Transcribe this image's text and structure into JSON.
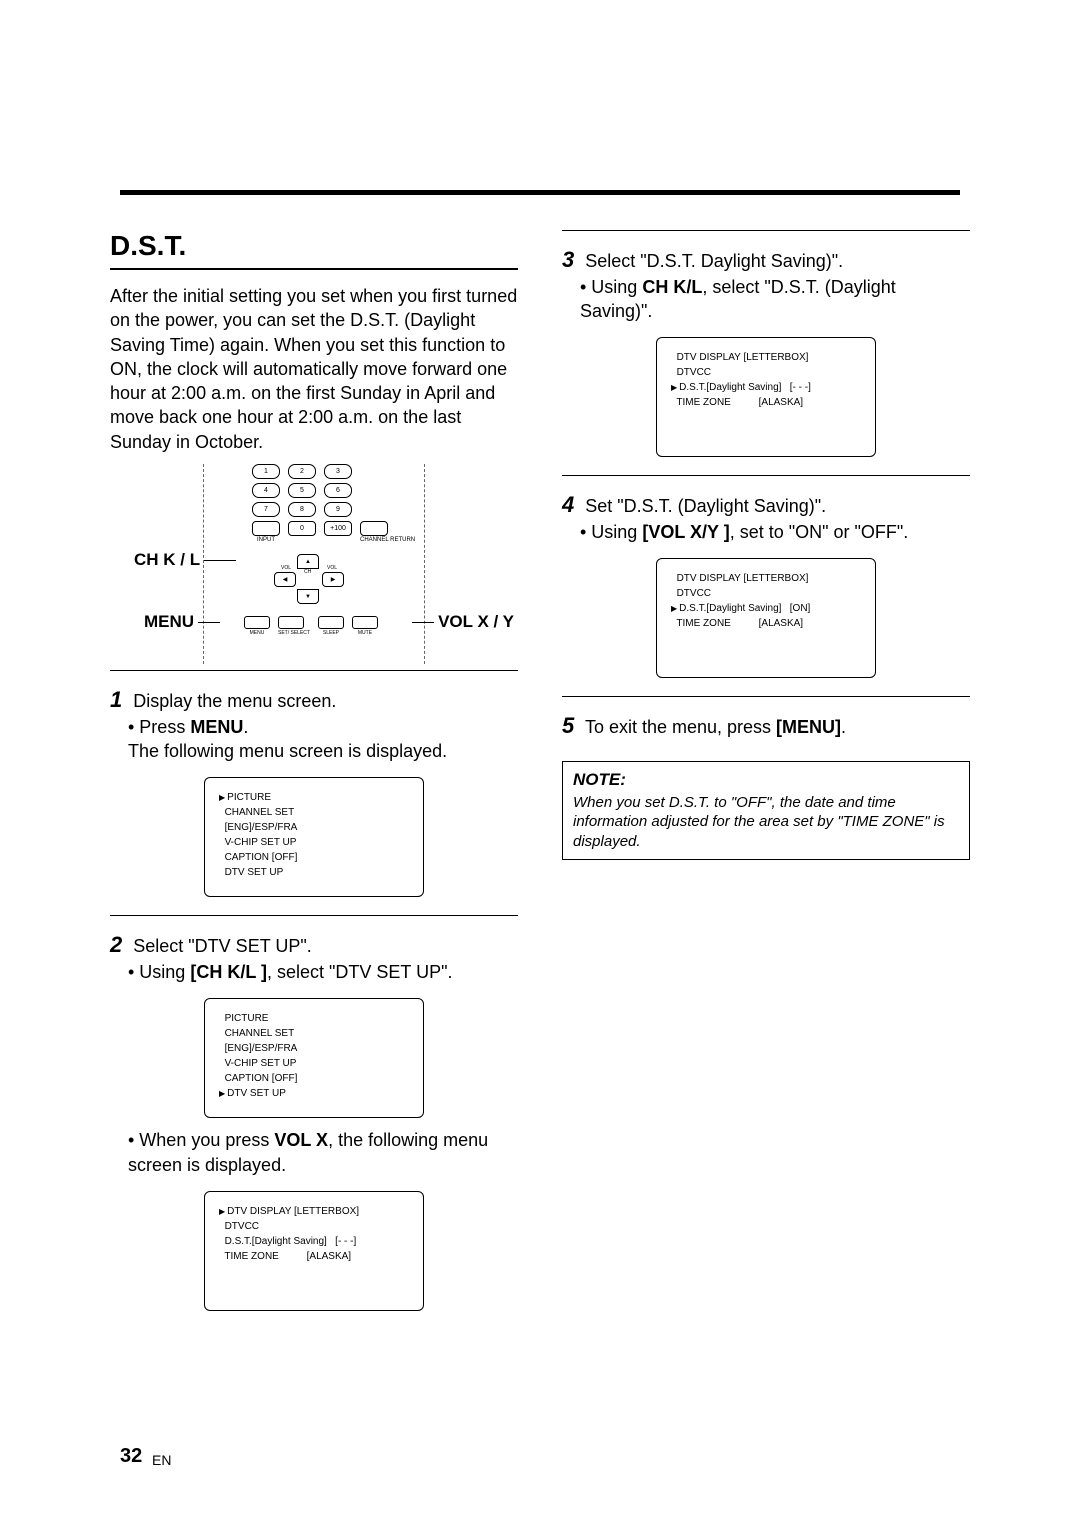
{
  "section_title": "D.S.T.",
  "intro": "After the initial setting you set when you first turned on the power, you can set the D.S.T. (Daylight Saving Time) again. When you set this function to ON, the clock will automatically move forward one hour at 2:00 a.m. on the first Sunday in April and move back one hour at 2:00 a.m. on the last Sunday in October.",
  "remote": {
    "label_ch": "CH K / L",
    "label_menu": "MENU",
    "label_vol": "VOL X / Y",
    "row4_labels": {
      "input": "INPUT",
      "plus": "+100",
      "chret": "CHANNEL\nRETURN"
    },
    "cross": {
      "up": "CH",
      "down": "CH",
      "left": "VOL",
      "right": "VOL"
    },
    "bottom": [
      "MENU",
      "SET/\nSELECT",
      "SLEEP",
      "MUTE"
    ]
  },
  "steps_left": [
    {
      "num": "1",
      "text": "Display the menu screen.",
      "sub": [
        "• Press ",
        "MENU",
        "."
      ],
      "sub2": "The following menu screen is displayed.",
      "screen": [
        {
          "arrow": true,
          "text": "PICTURE"
        },
        {
          "arrow": false,
          "text": "CHANNEL SET"
        },
        {
          "arrow": false,
          "text": "[ENG]/ESP/FRA"
        },
        {
          "arrow": false,
          "text": "V-CHIP SET UP"
        },
        {
          "arrow": false,
          "text": "CAPTION [OFF]"
        },
        {
          "arrow": false,
          "text": "DTV SET UP"
        }
      ]
    },
    {
      "num": "2",
      "text": "Select \"DTV SET UP\".",
      "sub": [
        "• Using ",
        "[CH K/L ]",
        ", select \"DTV SET UP\"."
      ],
      "screen": [
        {
          "arrow": false,
          "text": "PICTURE"
        },
        {
          "arrow": false,
          "text": "CHANNEL SET"
        },
        {
          "arrow": false,
          "text": "[ENG]/ESP/FRA"
        },
        {
          "arrow": false,
          "text": "V-CHIP SET UP"
        },
        {
          "arrow": false,
          "text": "CAPTION [OFF]"
        },
        {
          "arrow": true,
          "text": "DTV SET UP"
        }
      ],
      "sub3": [
        "• When you press ",
        "VOL X",
        ", the following menu screen is displayed."
      ],
      "screen2": [
        {
          "arrow": true,
          "text": "DTV DISPLAY [LETTERBOX]"
        },
        {
          "arrow": false,
          "text": "DTVCC"
        },
        {
          "arrow": false,
          "text": "D.S.T.[Daylight Saving]   [- - -]"
        },
        {
          "arrow": false,
          "text": "TIME ZONE          [ALASKA]"
        }
      ]
    }
  ],
  "steps_right": [
    {
      "num": "3",
      "text": "Select \"D.S.T. Daylight Saving)\".",
      "sub": [
        "• Using ",
        "CH K/L",
        ", select \"D.S.T. (Daylight Saving)\"."
      ],
      "screen": [
        {
          "arrow": false,
          "text": "DTV DISPLAY [LETTERBOX]"
        },
        {
          "arrow": false,
          "text": "DTVCC"
        },
        {
          "arrow": true,
          "text": "D.S.T.[Daylight Saving]   [- - -]"
        },
        {
          "arrow": false,
          "text": "TIME ZONE          [ALASKA]"
        }
      ]
    },
    {
      "num": "4",
      "text": "Set \"D.S.T. (Daylight Saving)\".",
      "sub": [
        "• Using ",
        "[VOL X/Y ]",
        ", set to \"ON\" or \"OFF\"."
      ],
      "screen": [
        {
          "arrow": false,
          "text": "DTV DISPLAY [LETTERBOX]"
        },
        {
          "arrow": false,
          "text": "DTVCC"
        },
        {
          "arrow": true,
          "text": "D.S.T.[Daylight Saving]   [ON]"
        },
        {
          "arrow": false,
          "text": "TIME ZONE          [ALASKA]"
        }
      ]
    },
    {
      "num": "5",
      "text_parts": [
        "To exit the menu, press ",
        "[MENU]",
        "."
      ]
    }
  ],
  "note": {
    "title": "NOTE:",
    "body": "When you set D.S.T. to \"OFF\", the date and time information adjusted for the area set by \"TIME ZONE\" is displayed."
  },
  "page_number": "32",
  "page_lang": "EN"
}
